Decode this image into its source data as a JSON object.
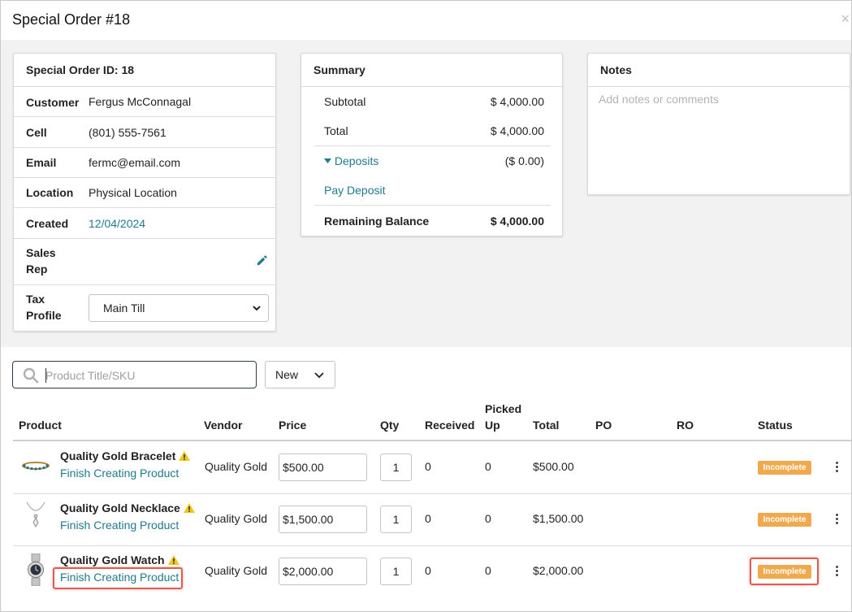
{
  "modal": {
    "title": "Special Order #18",
    "close": "×"
  },
  "details": {
    "header": "Special Order ID: 18",
    "customer_label": "Customer",
    "customer_value": "Fergus McConnagal",
    "cell_label": "Cell",
    "cell_value": "(801) 555-7561",
    "email_label": "Email",
    "email_value": "fermc@email.com",
    "location_label": "Location",
    "location_value": "Physical Location",
    "created_label": "Created",
    "created_value": "12/04/2024",
    "sales_rep_label_1": "Sales",
    "sales_rep_label_2": "Rep",
    "tax_profile_label_1": "Tax",
    "tax_profile_label_2": "Profile",
    "tax_profile_value": "Main Till"
  },
  "summary": {
    "header": "Summary",
    "subtotal_label": "Subtotal",
    "subtotal_value": "$ 4,000.00",
    "total_label": "Total",
    "total_value": "$ 4,000.00",
    "deposits_label": "Deposits",
    "deposits_value": "($ 0.00)",
    "pay_deposit": "Pay Deposit",
    "remaining_label": "Remaining Balance",
    "remaining_value": "$ 4,000.00"
  },
  "notes": {
    "header": "Notes",
    "placeholder": "Add notes or comments"
  },
  "search": {
    "placeholder": "Product Title/SKU"
  },
  "new_dropdown": {
    "label": "New"
  },
  "table": {
    "columns": {
      "product": "Product",
      "vendor": "Vendor",
      "price": "Price",
      "qty": "Qty",
      "received": "Received",
      "picked_1": "Picked",
      "picked_2": "Up",
      "total": "Total",
      "po": "PO",
      "ro": "RO",
      "status": "Status"
    },
    "rows": [
      {
        "name": "Quality Gold Bracelet",
        "action": "Finish Creating Product",
        "vendor": "Quality Gold",
        "price": "$500.00",
        "qty": "1",
        "received": "0",
        "picked_up": "0",
        "total": "$500.00",
        "status": "Incomplete",
        "thumb": "bracelet-icon"
      },
      {
        "name": "Quality Gold Necklace",
        "action": "Finish Creating Product",
        "vendor": "Quality Gold",
        "price": "$1,500.00",
        "qty": "1",
        "received": "0",
        "picked_up": "0",
        "total": "$1,500.00",
        "status": "Incomplete",
        "thumb": "necklace-icon"
      },
      {
        "name": "Quality Gold Watch",
        "action": "Finish Creating Product",
        "vendor": "Quality Gold",
        "price": "$2,000.00",
        "qty": "1",
        "received": "0",
        "picked_up": "0",
        "total": "$2,000.00",
        "status": "Incomplete",
        "thumb": "watch-icon"
      }
    ]
  },
  "colors": {
    "link": "#1f7a8c",
    "status_badge": "#f0a94c",
    "highlight": "#e05a4f",
    "warning": "#f5c518"
  }
}
